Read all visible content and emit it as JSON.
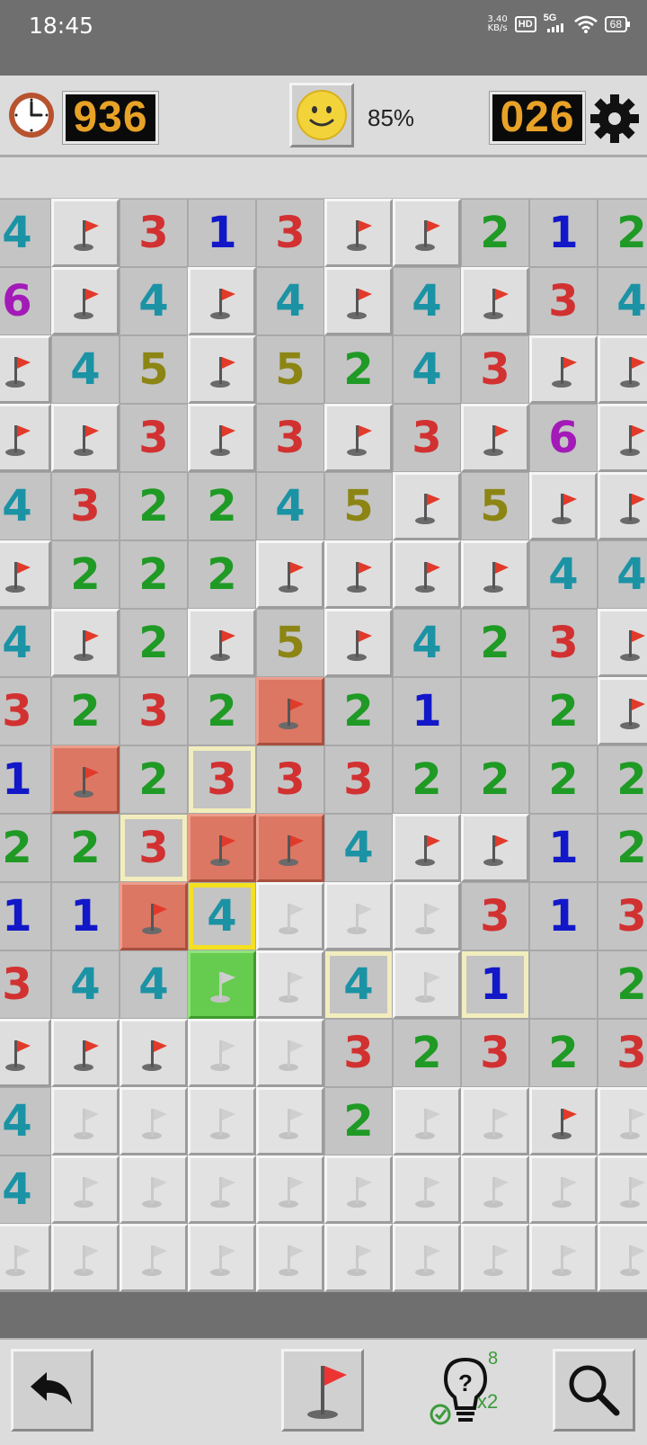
{
  "status_bar": {
    "time": "18:45",
    "speed_value": "3.40",
    "speed_unit": "KB/s",
    "hd": "HD",
    "network": "5G",
    "battery": "68"
  },
  "header": {
    "timer": "936",
    "progress": "85%",
    "mines_left": "026"
  },
  "colors": {
    "1": "#1218c8",
    "2": "#1f9a25",
    "3": "#d23131",
    "4": "#1b93a5",
    "5": "#8c8514",
    "6": "#a31ab8",
    "revealed_bg": "#c4c4c4",
    "covered_bg": "#dedede",
    "wrong_flag_bg": "#dc7763",
    "hint_cell_bg": "#66cc4f"
  },
  "board": {
    "cols": 10,
    "rows": 16,
    "legend": "digit = revealed number, F = flag, R = flag on red cell, e = empty revealed, f = faded flag (covered), G = green hint cell",
    "cells": [
      [
        "4",
        "F",
        "3",
        "1",
        "3",
        "F",
        "F",
        "2",
        "1",
        "2"
      ],
      [
        "6",
        "F",
        "4",
        "F",
        "4",
        "F",
        "4",
        "F",
        "3",
        "4"
      ],
      [
        "F",
        "4",
        "5",
        "F",
        "5",
        "2",
        "4",
        "3",
        "F",
        "F"
      ],
      [
        "F",
        "F",
        "3",
        "F",
        "3",
        "F",
        "3",
        "F",
        "6",
        "F"
      ],
      [
        "4",
        "3",
        "2",
        "2",
        "4",
        "5",
        "F",
        "5",
        "F",
        "F"
      ],
      [
        "F",
        "2",
        "2",
        "2",
        "F",
        "F",
        "F",
        "F",
        "4",
        "4"
      ],
      [
        "4",
        "F",
        "2",
        "F",
        "5",
        "F",
        "4",
        "2",
        "3",
        "F"
      ],
      [
        "3",
        "2",
        "3",
        "2",
        "R",
        "2",
        "1",
        "e",
        "2",
        "F"
      ],
      [
        "1",
        "R",
        "2",
        "3",
        "3",
        "3",
        "2",
        "2",
        "2",
        "2"
      ],
      [
        "2",
        "2",
        "3",
        "R",
        "R",
        "4",
        "F",
        "F",
        "1",
        "2"
      ],
      [
        "1",
        "1",
        "R",
        "4",
        "f",
        "f",
        "f",
        "3",
        "1",
        "3"
      ],
      [
        "3",
        "4",
        "4",
        "G",
        "f",
        "4",
        "f",
        "1",
        "e",
        "2"
      ],
      [
        "F",
        "F",
        "F",
        "f",
        "f",
        "3",
        "2",
        "3",
        "2",
        "3"
      ],
      [
        "4",
        "f",
        "f",
        "f",
        "f",
        "2",
        "f",
        "f",
        "F",
        "f"
      ],
      [
        "4",
        "f",
        "f",
        "f",
        "f",
        "f",
        "f",
        "f",
        "f",
        "f"
      ],
      [
        "f",
        "f",
        "f",
        "f",
        "f",
        "f",
        "f",
        "f",
        "f",
        "f"
      ]
    ],
    "highlights": [
      {
        "row": 8,
        "col": 3,
        "style": "cream"
      },
      {
        "row": 9,
        "col": 2,
        "style": "cream"
      },
      {
        "row": 10,
        "col": 3,
        "style": "yellow"
      },
      {
        "row": 11,
        "col": 5,
        "style": "cream"
      },
      {
        "row": 11,
        "col": 7,
        "style": "cream"
      }
    ]
  },
  "toolbar": {
    "undo_icon": "undo-arrow-icon",
    "flag_mode_icon": "flag-icon",
    "hint_icon": "lightbulb-question-icon",
    "hint_count": "8",
    "hint_multiplier": "x2",
    "zoom_icon": "magnifier-icon"
  }
}
